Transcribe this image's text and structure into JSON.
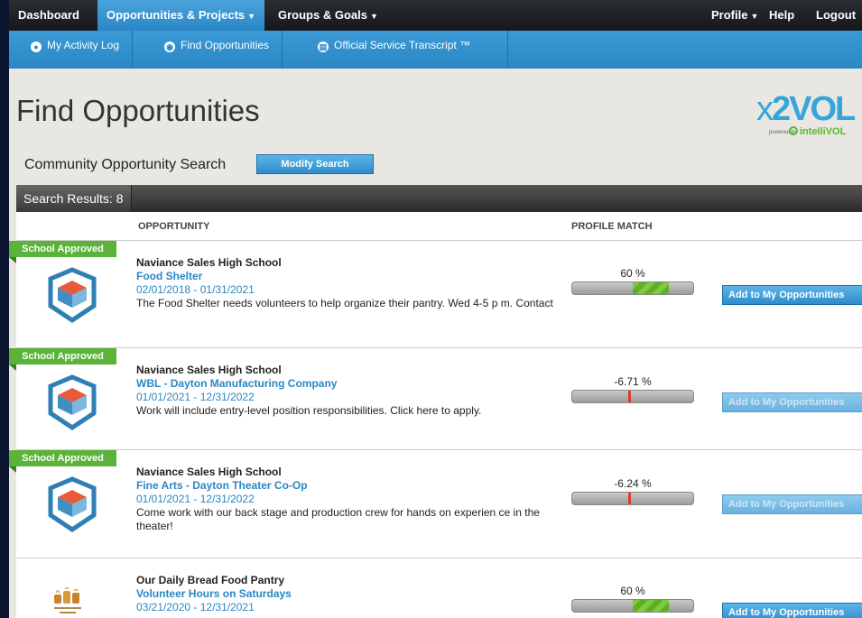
{
  "nav": {
    "dashboard": "Dashboard",
    "opportunities": "Opportunities & Projects",
    "groups": "Groups & Goals",
    "profile": "Profile",
    "help": "Help",
    "logout": "Logout"
  },
  "subnav": {
    "activity_log": "My Activity Log",
    "find_opportunities": "Find Opportunities",
    "transcript": "Official Service Transcript ™"
  },
  "page": {
    "title": "Find Opportunities",
    "search_label": "Community Opportunity Search",
    "modify_button": "Modify Search"
  },
  "logo": {
    "x": "x",
    "two": "2",
    "vol": "VOL",
    "powered_by": "powered by",
    "intelli": "intelliVOL"
  },
  "results": {
    "header": "Search Results: 8",
    "col_opportunity": "OPPORTUNITY",
    "col_match": "PROFILE MATCH",
    "ribbon_label": "School Approved",
    "add_label": "Add to My Opportunities",
    "rows": [
      {
        "org": "Naviance Sales High School",
        "title": "Food Shelter",
        "dates": "02/01/2018 - 01/31/2021",
        "desc": "The Food Shelter needs volunteers to help organize their pantry. Wed 4-5 p m. Contact",
        "match_text": "60 %",
        "match": 60
      },
      {
        "org": "Naviance Sales High School",
        "title": "WBL - Dayton Manufacturing Company",
        "dates": "01/01/2021 - 12/31/2022",
        "desc": "Work will include entry-level position responsibilities. Click here to apply.",
        "match_text": "-6.71 %",
        "match": -6.71
      },
      {
        "org": "Naviance Sales High School",
        "title": "Fine Arts - Dayton Theater Co-Op",
        "dates": "01/01/2021 - 12/31/2022",
        "desc": "Come work with our back stage and production crew for hands on experien ce in the theater!",
        "match_text": "-6.24 %",
        "match": -6.24
      },
      {
        "org": "Our Daily Bread Food Pantry",
        "title": "Volunteer Hours on Saturdays",
        "dates": "03/21/2020 - 12/31/2021",
        "match_text": "60 %",
        "match": 60
      }
    ]
  },
  "colors": {
    "accent": "#2a87c4",
    "approved": "#5bb33a",
    "match_fill": "#6dbb31",
    "match_negative": "#e23b2b"
  }
}
